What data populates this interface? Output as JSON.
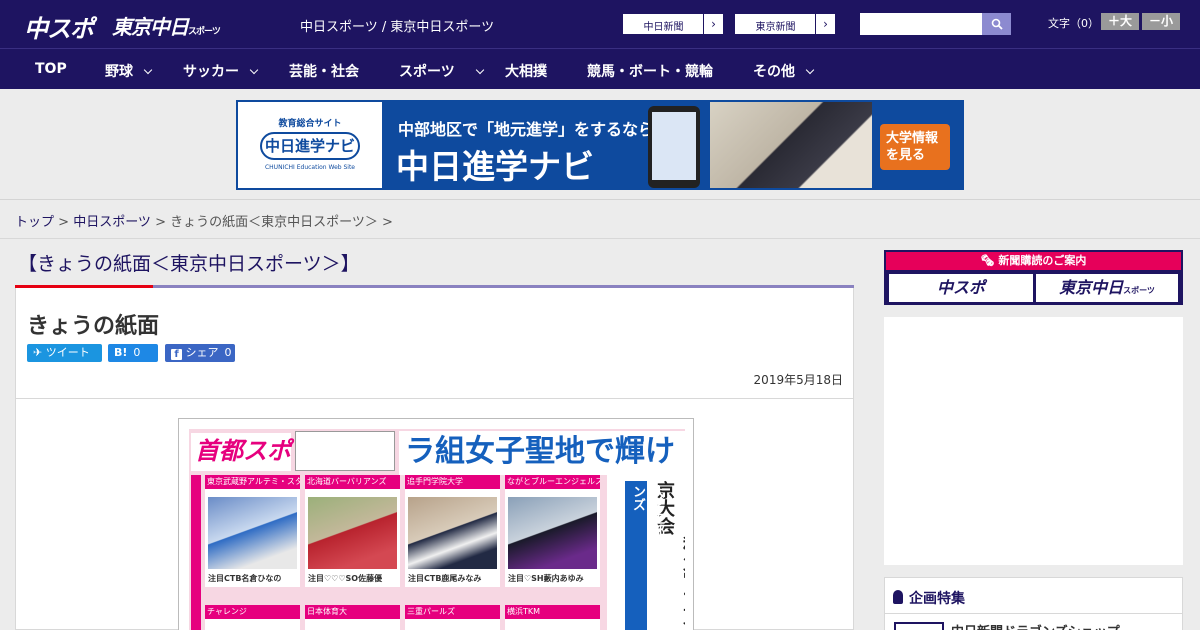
{
  "header": {
    "logo_chuspo": "中スポ",
    "logo_tokyo": "東京中日",
    "logo_tokyo_small": "スポーツ",
    "site_name": "中日スポーツ / 東京中日スポーツ",
    "ext_links": [
      {
        "label": "中日新聞"
      },
      {
        "label": "東京新聞"
      }
    ],
    "search": {
      "placeholder": ""
    },
    "font_size": {
      "label": "文字（0）",
      "plus": "＋大",
      "minus": "－小"
    }
  },
  "nav": {
    "items": [
      {
        "label": "TOP",
        "dropdown": false
      },
      {
        "label": "野球",
        "dropdown": true
      },
      {
        "label": "サッカー",
        "dropdown": true
      },
      {
        "label": "芸能・社会",
        "dropdown": false
      },
      {
        "label": "スポーツ",
        "dropdown": true
      },
      {
        "label": "大相撲",
        "dropdown": false
      },
      {
        "label": "競馬・ボート・競輪",
        "dropdown": false
      },
      {
        "label": "その他",
        "dropdown": true
      }
    ]
  },
  "ad_banner": {
    "logo_top": "教育総合サイト",
    "logo_main": "中日進学ナビ",
    "logo_sub": "CHUNICHI Education Web Site",
    "tagline": "中部地区で「地元進学」をするなら",
    "title": "中日進学ナビ",
    "cta": "大学情報を見る"
  },
  "breadcrumb": {
    "home": "トップ",
    "section": "中日スポーツ",
    "current": "きょうの紙面＜東京中日スポーツ＞",
    "separator": " > "
  },
  "main": {
    "page_heading": "【きょうの紙面＜東京中日スポーツ＞】",
    "article_title": "きょうの紙面",
    "share": {
      "tweet": "ツイート",
      "hatena": "B!",
      "hatena_count": "0",
      "facebook": "シェア",
      "facebook_count": "0"
    },
    "date": "2019年5月18日",
    "newspaper": {
      "logo": "首都スポ",
      "headline": "ラ組女子聖地で輝け",
      "vertical_main": "きょう秩父宮で東京大会",
      "vertical_sub": "大学生部ウィメンズセブンズ",
      "teams_top": [
        {
          "caption": "東京武蔵野アルテミ・スターズ",
          "name": "注目CTB名倉ひなの"
        },
        {
          "caption": "北海道バーバリアンズ",
          "name": "注目♡♡♡SO佐藤優"
        },
        {
          "caption": "追手門学院大学",
          "name": "注目CTB鹿尾みなみ"
        },
        {
          "caption": "ながとブルーエンジェルス",
          "name": "注目♡SH藪内あゆみ"
        }
      ],
      "teams_bottom": [
        {
          "caption": "チャレンジ"
        },
        {
          "caption": "日本体育大"
        },
        {
          "caption": "三重パールズ"
        },
        {
          "caption": "横浜TKM"
        }
      ]
    }
  },
  "sidebar": {
    "subscribe_head": "新聞購読のご案内",
    "subscribe_chuspo": "中スポ",
    "subscribe_tokyo": "東京中日",
    "subscribe_tokyo_small": "スポーツ",
    "feature_title": "企画特集",
    "feature_item": "中日新聞ドラゴンズショップ"
  },
  "colors": {
    "brand_navy": "#1e1461",
    "accent_red": "#e60012",
    "heading_bar": "#8a82c0"
  }
}
